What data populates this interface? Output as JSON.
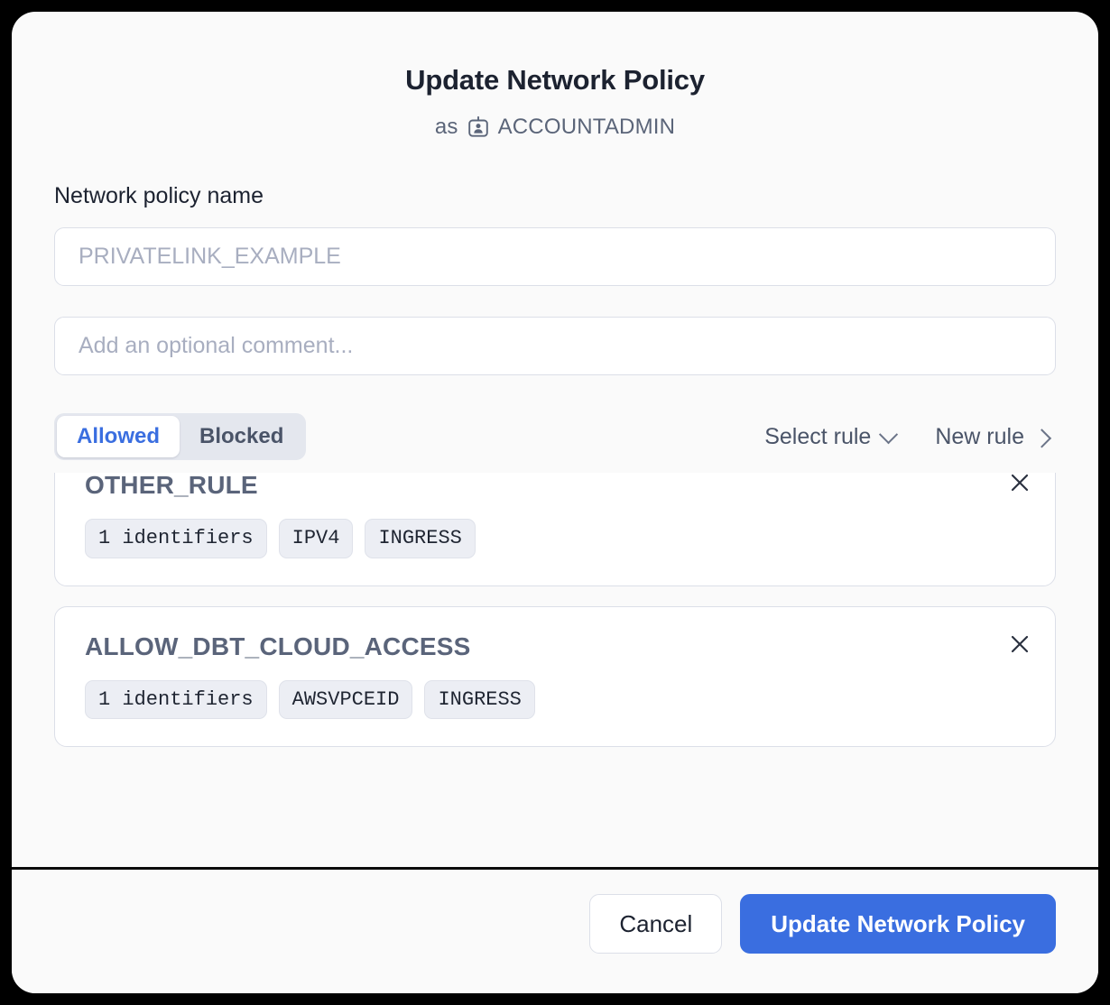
{
  "dialog": {
    "title": "Update Network Policy",
    "role_prefix": "as",
    "role_name": "ACCOUNTADMIN",
    "role_icon": "id-badge-icon"
  },
  "form": {
    "name_label": "Network policy name",
    "name_value": "",
    "name_placeholder": "PRIVATELINK_EXAMPLE",
    "comment_value": "",
    "comment_placeholder": "Add an optional comment..."
  },
  "toolbar": {
    "segments": [
      {
        "label": "Allowed",
        "active": true
      },
      {
        "label": "Blocked",
        "active": false
      }
    ],
    "select_rule_label": "Select rule",
    "select_rule_icon": "chevron-down-icon",
    "new_rule_label": "New rule",
    "new_rule_icon": "chevron-right-icon"
  },
  "rules": [
    {
      "name": "OTHER_RULE",
      "chips": [
        "1 identifiers",
        "IPV4",
        "INGRESS"
      ],
      "remove_icon": "close-icon"
    },
    {
      "name": "ALLOW_DBT_CLOUD_ACCESS",
      "chips": [
        "1 identifiers",
        "AWSVPCEID",
        "INGRESS"
      ],
      "remove_icon": "close-icon"
    }
  ],
  "footer": {
    "cancel_label": "Cancel",
    "submit_label": "Update Network Policy"
  },
  "colors": {
    "accent": "#3a6ee0",
    "modal_bg": "#fafafa",
    "text_primary": "#1c2230",
    "text_muted": "#5b6579",
    "chip_bg": "#eceef4",
    "border": "#dcdfe8"
  }
}
